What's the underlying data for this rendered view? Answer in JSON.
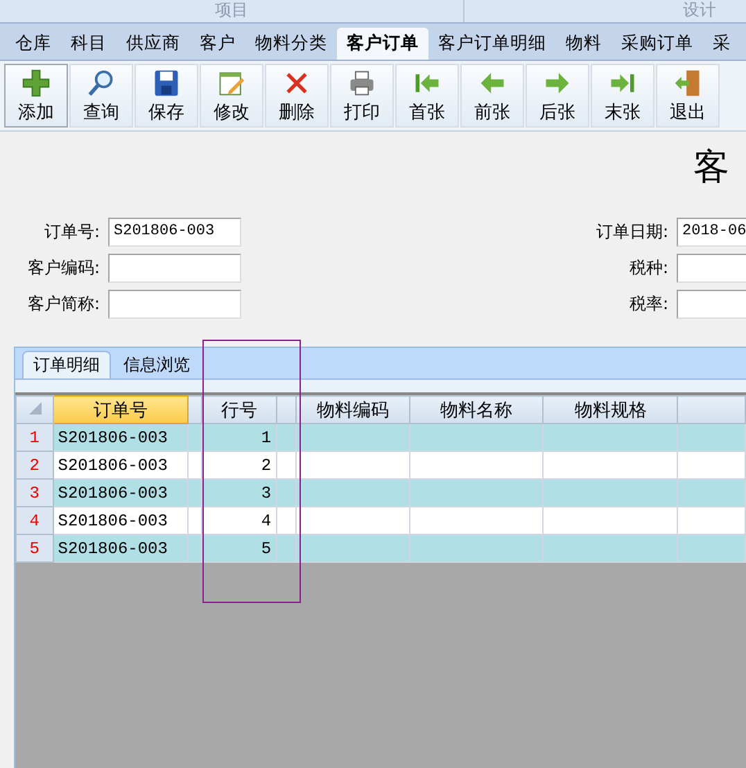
{
  "ribbon_groups": [
    "项目",
    "设计"
  ],
  "menu_tabs": [
    {
      "label": "仓库",
      "selected": false
    },
    {
      "label": "科目",
      "selected": false
    },
    {
      "label": "供应商",
      "selected": false
    },
    {
      "label": "客户",
      "selected": false
    },
    {
      "label": "物料分类",
      "selected": false
    },
    {
      "label": "客户订单",
      "selected": true
    },
    {
      "label": "客户订单明细",
      "selected": false
    },
    {
      "label": "物料",
      "selected": false
    },
    {
      "label": "采购订单",
      "selected": false
    },
    {
      "label": "采",
      "selected": false
    }
  ],
  "toolbar": [
    "添加",
    "查询",
    "保存",
    "修改",
    "删除",
    "打印",
    "首张",
    "前张",
    "后张",
    "末张",
    "退出"
  ],
  "form": {
    "title": "客",
    "left_fields": [
      {
        "label": "订单号:",
        "value": "S201806-003"
      },
      {
        "label": "客户编码:"
      },
      {
        "label": "客户简称:"
      }
    ],
    "right_fields": [
      {
        "label": "订单日期:",
        "value": "2018-06"
      },
      {
        "label": "税种:"
      },
      {
        "label": "税率:"
      }
    ]
  },
  "detail_tabs": [
    {
      "label": "订单明细",
      "selected": true
    },
    {
      "label": "信息浏览",
      "selected": false
    }
  ],
  "grid": {
    "columns": [
      {
        "label": "订单号",
        "selected": true
      },
      {
        "selected": false
      },
      {
        "label": "行号",
        "selected": false
      },
      {
        "selected": false
      },
      {
        "label": "物料编码",
        "selected": false
      },
      {
        "label": "物料名称",
        "selected": false
      },
      {
        "label": "物料规格",
        "selected": false
      },
      {
        "selected": false
      }
    ],
    "rows": [
      {
        "number": "1",
        "cells": [
          "S201806-003",
          "",
          "1",
          "",
          "",
          "",
          "",
          ""
        ]
      },
      {
        "number": "2",
        "cells": [
          "S201806-003",
          "",
          "2",
          "",
          "",
          "",
          "",
          ""
        ]
      },
      {
        "number": "3",
        "cells": [
          "S201806-003",
          "",
          "3",
          "",
          "",
          "",
          "",
          ""
        ]
      },
      {
        "number": "4",
        "cells": [
          "S201806-003",
          "",
          "4",
          "",
          "",
          "",
          "",
          ""
        ]
      },
      {
        "number": "5",
        "cells": [
          "S201806-003",
          "",
          "5",
          "",
          "",
          "",
          "",
          ""
        ]
      }
    ]
  }
}
